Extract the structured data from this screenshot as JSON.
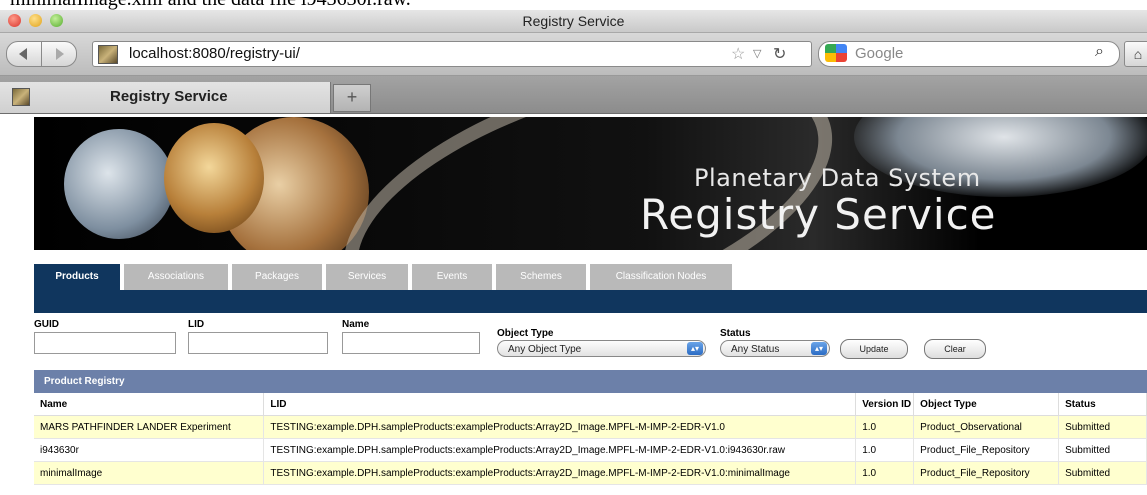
{
  "doc_strip_text": "minimalImage.xml and the data file i943630r.raw.",
  "window": {
    "title": "Registry Service"
  },
  "toolbar": {
    "url": "localhost:8080/registry-ui/",
    "search_placeholder": "Google"
  },
  "browser_tab": {
    "label": "Registry Service",
    "new_tab": "+"
  },
  "banner": {
    "subtitle": "Planetary Data System",
    "title": "Registry Service"
  },
  "app_tabs": [
    "Products",
    "Associations",
    "Packages",
    "Services",
    "Events",
    "Schemes",
    "Classification Nodes"
  ],
  "filters": {
    "guid_label": "GUID",
    "lid_label": "LID",
    "name_label": "Name",
    "object_type_label": "Object Type",
    "object_type_value": "Any Object Type",
    "status_label": "Status",
    "status_value": "Any Status",
    "update_label": "Update",
    "clear_label": "Clear"
  },
  "registry": {
    "title": "Product Registry",
    "columns": [
      "Name",
      "LID",
      "Version ID",
      "Object Type",
      "Status"
    ],
    "rows": [
      [
        "MARS PATHFINDER LANDER Experiment",
        "TESTING:example.DPH.sampleProducts:exampleProducts:Array2D_Image.MPFL-M-IMP-2-EDR-V1.0",
        "1.0",
        "Product_Observational",
        "Submitted"
      ],
      [
        "i943630r",
        "TESTING:example.DPH.sampleProducts:exampleProducts:Array2D_Image.MPFL-M-IMP-2-EDR-V1.0:i943630r.raw",
        "1.0",
        "Product_File_Repository",
        "Submitted"
      ],
      [
        "minimalImage",
        "TESTING:example.DPH.sampleProducts:exampleProducts:Array2D_Image.MPFL-M-IMP-2-EDR-V1.0:minimalImage",
        "1.0",
        "Product_File_Repository",
        "Submitted"
      ]
    ]
  }
}
